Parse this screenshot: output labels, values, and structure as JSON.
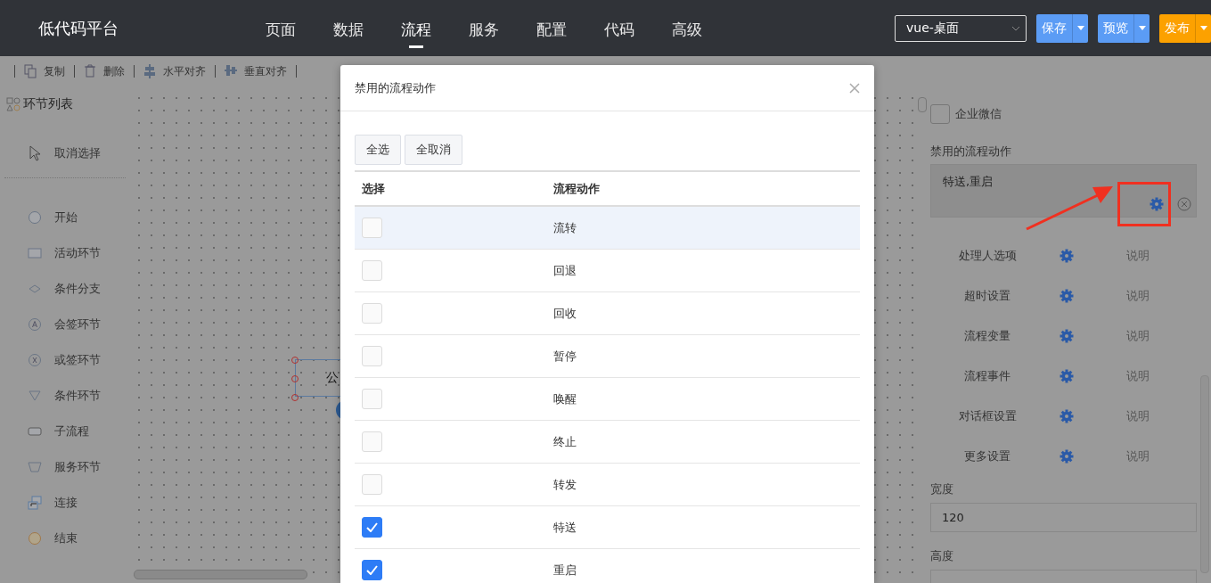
{
  "header": {
    "logo": "低代码平台",
    "nav": [
      {
        "label": "页面",
        "selected": false
      },
      {
        "label": "数据",
        "selected": false
      },
      {
        "label": "流程",
        "selected": true
      },
      {
        "label": "服务",
        "selected": false
      },
      {
        "label": "配置",
        "selected": false
      },
      {
        "label": "代码",
        "selected": false
      },
      {
        "label": "高级",
        "selected": false
      }
    ],
    "template_select": {
      "value": "vue-桌面"
    },
    "buttons": [
      {
        "label": "保存",
        "kind": "primary"
      },
      {
        "label": "预览",
        "kind": "primary"
      },
      {
        "label": "发布",
        "kind": "warning"
      }
    ]
  },
  "toolbar": [
    {
      "label": "复制",
      "kind": "copy"
    },
    {
      "label": "删除",
      "kind": "delete"
    },
    {
      "label": "水平对齐",
      "kind": "align-h"
    },
    {
      "label": "垂直对齐",
      "kind": "align-v"
    }
  ],
  "palette": {
    "title": "环节列表",
    "cancel": "取消选择",
    "items": [
      {
        "label": "开始",
        "kind": "circle"
      },
      {
        "label": "活动环节",
        "kind": "rect"
      },
      {
        "label": "条件分支",
        "kind": "diamond"
      },
      {
        "label": "会签环节",
        "kind": "circle-mark"
      },
      {
        "label": "或签环节",
        "kind": "circle-cross"
      },
      {
        "label": "条件环节",
        "kind": "triangle"
      },
      {
        "label": "子流程",
        "kind": "rounded"
      },
      {
        "label": "服务环节",
        "kind": "trapezoid"
      },
      {
        "label": "连接",
        "kind": "link"
      },
      {
        "label": "结束",
        "kind": "end"
      }
    ]
  },
  "canvas": {
    "node": "公"
  },
  "properties": {
    "checkbox": {
      "label": "企业微信",
      "checked": false
    },
    "disabled_actions": {
      "label": "禁用的流程动作",
      "value": "特送,重启"
    },
    "settings": [
      {
        "label": "处理人选项",
        "help": "说明"
      },
      {
        "label": "超时设置",
        "help": "说明"
      },
      {
        "label": "流程变量",
        "help": "说明"
      },
      {
        "label": "流程事件",
        "help": "说明"
      },
      {
        "label": "对话框设置",
        "help": "说明"
      },
      {
        "label": "更多设置",
        "help": "说明"
      }
    ],
    "fields": [
      {
        "label": "宽度",
        "value": "120"
      },
      {
        "label": "高度"
      }
    ]
  },
  "dialog": {
    "title": "禁用的流程动作",
    "buttons": [
      "全选",
      "全取消"
    ],
    "columns": [
      "选择",
      "流程动作"
    ],
    "rows": [
      {
        "action": "流转",
        "checked": false,
        "selected": true
      },
      {
        "action": "回退",
        "checked": false,
        "selected": false
      },
      {
        "action": "回收",
        "checked": false,
        "selected": false
      },
      {
        "action": "暂停",
        "checked": false,
        "selected": false
      },
      {
        "action": "唤醒",
        "checked": false,
        "selected": false
      },
      {
        "action": "终止",
        "checked": false,
        "selected": false
      },
      {
        "action": "转发",
        "checked": false,
        "selected": false
      },
      {
        "action": "特送",
        "checked": true,
        "selected": false
      },
      {
        "action": "重启",
        "checked": true,
        "selected": false
      }
    ]
  }
}
